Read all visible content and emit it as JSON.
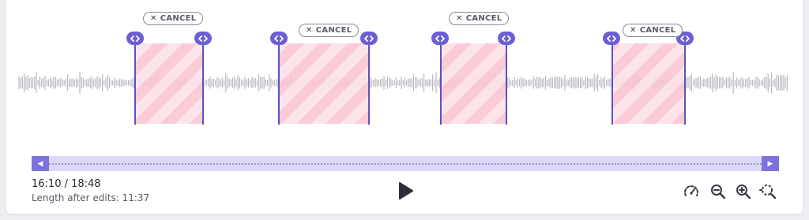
{
  "timeline": {
    "cuts": [
      {
        "cancel_label": "CANCEL"
      },
      {
        "cancel_label": "CANCEL"
      },
      {
        "cancel_label": "CANCEL"
      },
      {
        "cancel_label": "CANCEL"
      }
    ]
  },
  "playback": {
    "time_readout": "16:10 / 18:48",
    "length_after_edits": "Length after edits: 11:37"
  },
  "colors": {
    "accent": "#6c5fd6",
    "cut_stripe_dark": "#f9c7d4",
    "cut_stripe_light": "#fde1e8",
    "waveform": "#b9b9c0"
  },
  "icons": {
    "handle": "chevrons-left-right-icon",
    "cancel": "close-icon",
    "play": "play-icon",
    "speed": "playback-speed-icon",
    "zoom_out": "zoom-out-icon",
    "zoom_in": "zoom-in-icon",
    "zoom_fit": "zoom-fit-icon"
  }
}
